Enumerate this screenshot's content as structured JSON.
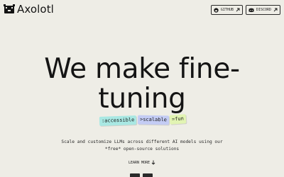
{
  "header": {
    "logo_text": "Axolotl",
    "logo_icon": "axolotl-logo-icon",
    "nav": [
      {
        "label": "GITHUB",
        "icon": "github-icon"
      },
      {
        "label": "DISCORD",
        "icon": "discord-icon"
      }
    ],
    "external_icon": "external-link-icon"
  },
  "hero": {
    "headline_line1": "We make fine-",
    "headline_line2": "tuning",
    "pills": [
      ":accessible",
      ">scalable",
      "=fun"
    ],
    "pill_colors": [
      "#a9e8e3",
      "#c4ccf4",
      "#e2f4b3"
    ],
    "description_line1": "Scale and customize LLMs across different AI models using our",
    "description_line2": "*free* open-source solutions",
    "learn_more": "LEARN MORE",
    "learn_more_icon": "arrow-down-icon"
  },
  "colors": {
    "background": "#eeede6",
    "text": "#141414"
  }
}
